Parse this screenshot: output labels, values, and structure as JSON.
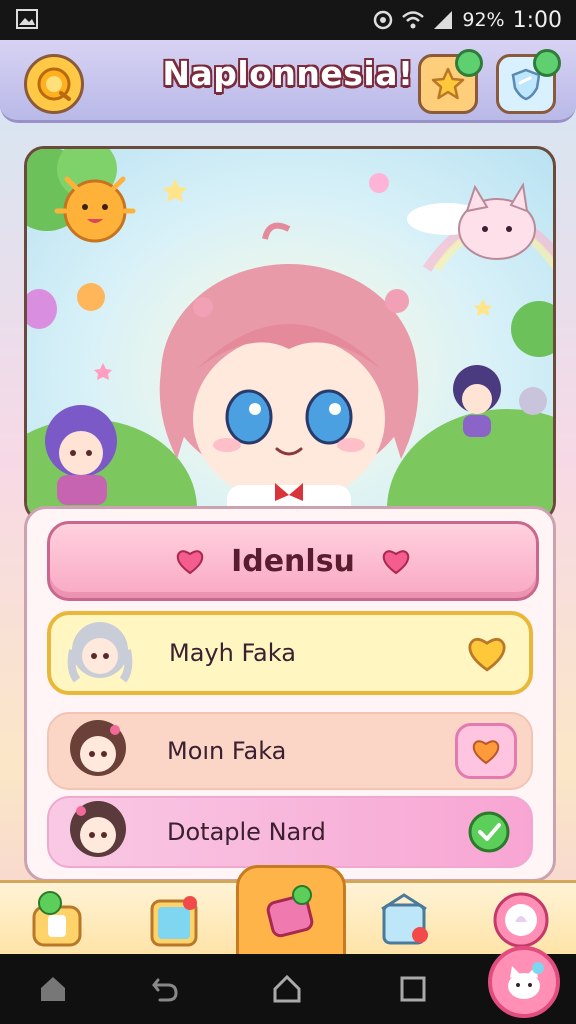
{
  "status_bar": {
    "battery": "92%",
    "time": "1:00"
  },
  "header": {
    "title": "Naplonnesia!",
    "left_icon": "sun-coin-icon",
    "right_icons": [
      "star-icon",
      "shield-icon"
    ]
  },
  "panel": {
    "title": "Idenlsu",
    "rows": [
      {
        "label": "Mayh Faka",
        "action_icon": "heart-icon",
        "selected": true
      },
      {
        "label": "Moın Faka",
        "action_icon": "heart-icon",
        "selected": false
      },
      {
        "label": "Dotaple Nard",
        "action_icon": "checkmark-icon",
        "selected": false
      }
    ]
  },
  "tabs": [
    "character-tab",
    "gallery-tab",
    "outfit-tab",
    "home-tab",
    "gacha-tab"
  ],
  "colors": {
    "accent_pink": "#f9a8c3",
    "title_outline": "#7a2a3a",
    "selected_row_border": "#e9b83a"
  }
}
